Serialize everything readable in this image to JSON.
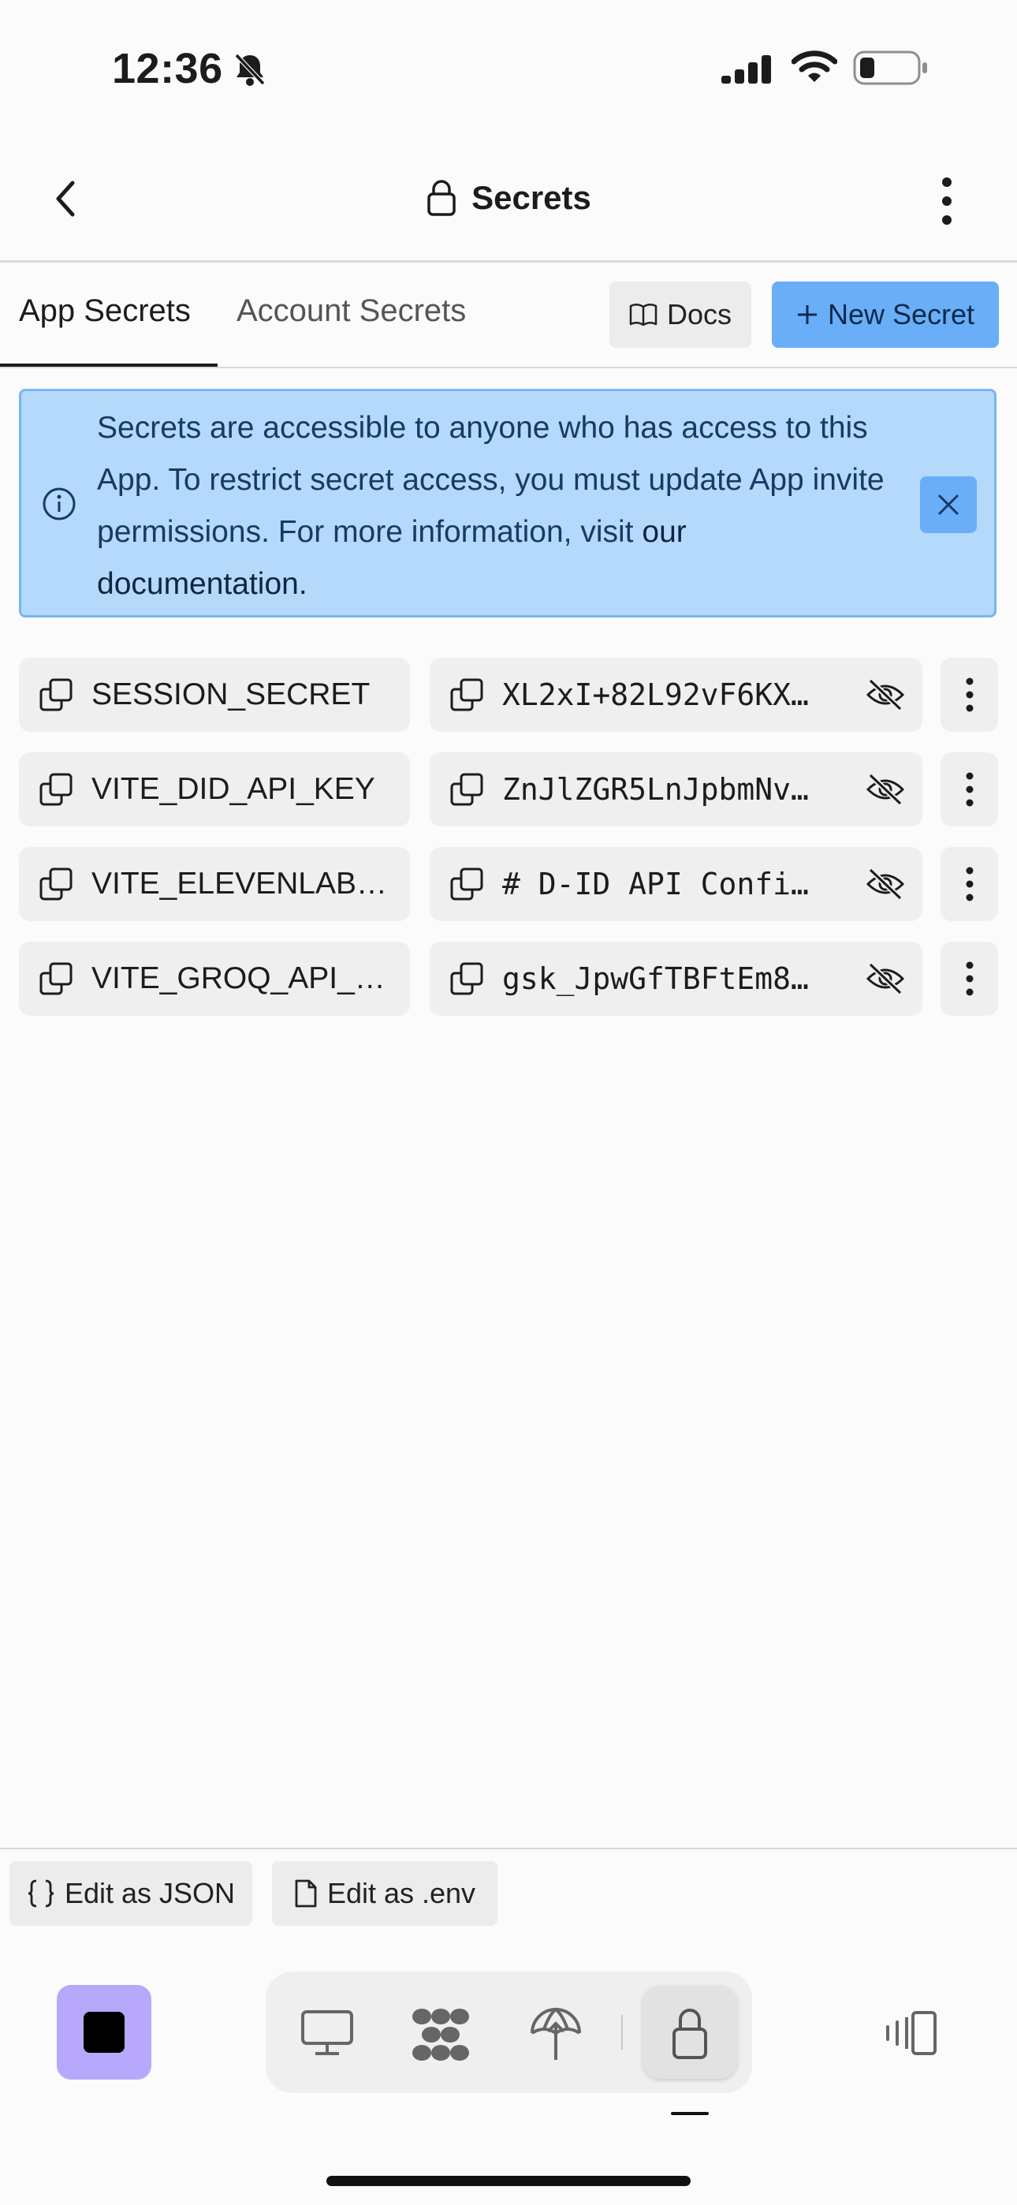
{
  "status_bar": {
    "time": "12:36"
  },
  "header": {
    "title": "Secrets"
  },
  "tabs": [
    {
      "label": "App Secrets",
      "active": true
    },
    {
      "label": "Account Secrets",
      "active": false
    }
  ],
  "actions": {
    "docs_label": "Docs",
    "new_secret_label": "New Secret"
  },
  "banner": {
    "text": "Secrets are accessible to anyone who has access to this App. To restrict secret access, you must update App invite permissions. For more information, visit",
    "link_text": "our documentation."
  },
  "secrets": [
    {
      "key": "SESSION_SECRET",
      "value": "XL2xI+82L92vF6KX…"
    },
    {
      "key": "VITE_DID_API_KEY",
      "value": "ZnJlZGR5LnJpbmNv…"
    },
    {
      "key": "VITE_ELEVENLAB…",
      "value": "# D-ID API Confi…"
    },
    {
      "key": "VITE_GROQ_API_…",
      "value": "gsk_JpwGfTBFtEm8…"
    }
  ],
  "footer": {
    "edit_json_label": "Edit as JSON",
    "edit_env_label": "Edit as .env"
  },
  "colors": {
    "accent": "#6aaef7",
    "banner_bg": "#b4d9fb",
    "stop_button": "#b8a8fb"
  }
}
